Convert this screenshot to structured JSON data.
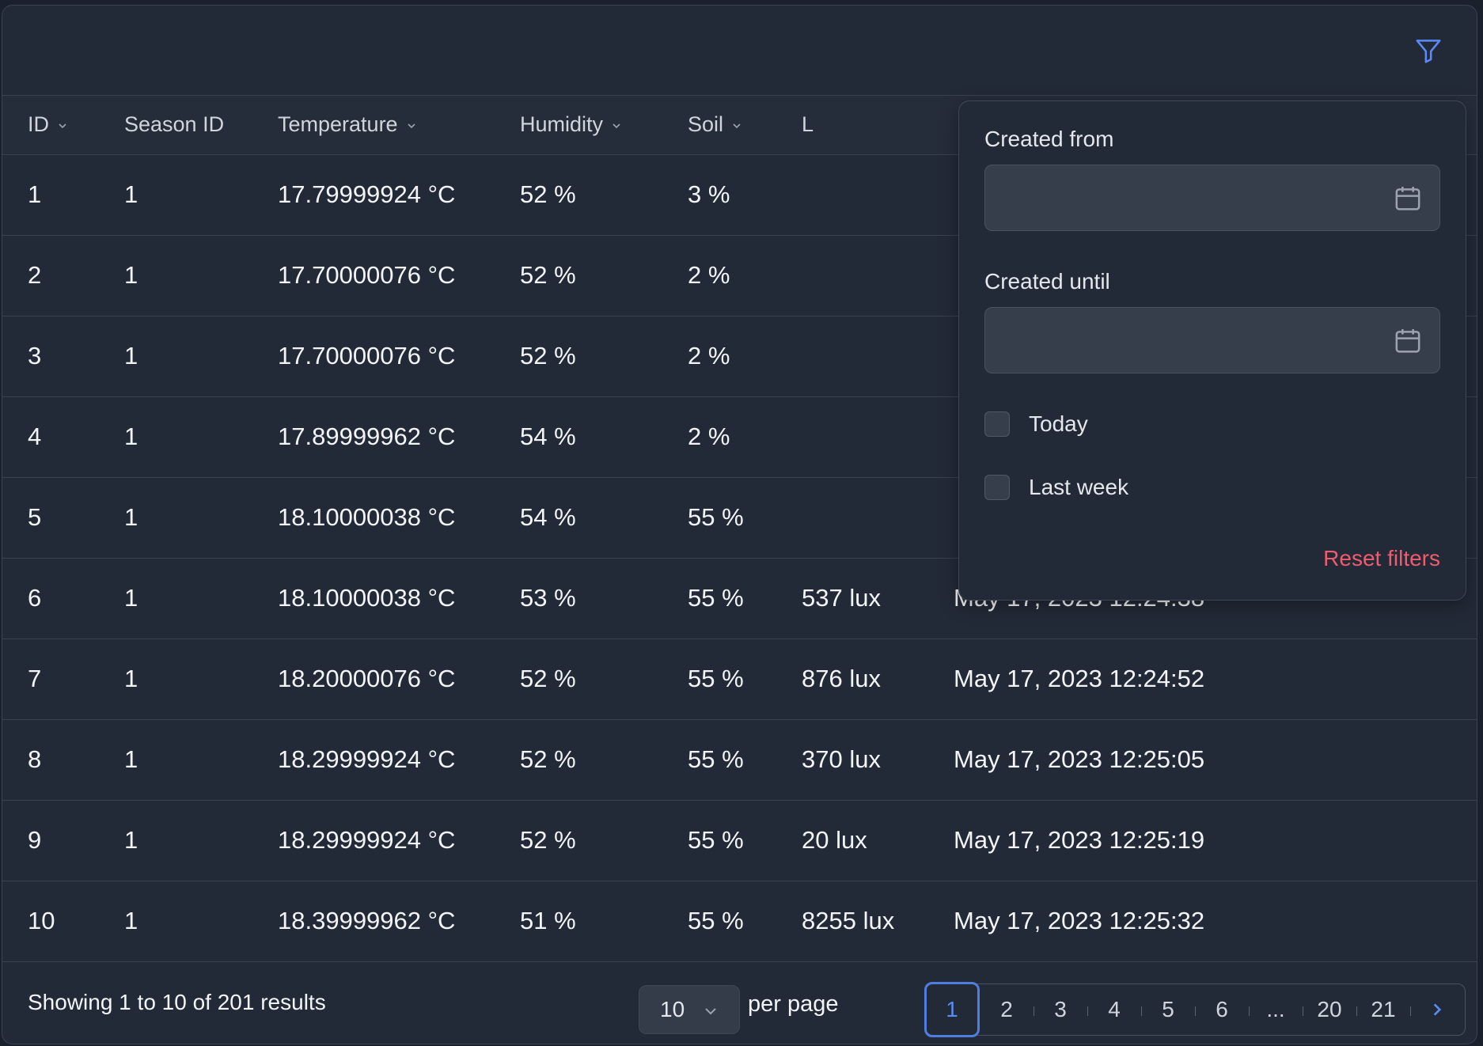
{
  "table": {
    "columns": [
      "ID",
      "Season ID",
      "Temperature",
      "Humidity",
      "Soil",
      "L",
      ""
    ],
    "rows": [
      [
        "1",
        "1",
        "17.79999924 °C",
        "52 %",
        "3 %",
        "",
        ""
      ],
      [
        "2",
        "1",
        "17.70000076 °C",
        "52 %",
        "2 %",
        "",
        ""
      ],
      [
        "3",
        "1",
        "17.70000076 °C",
        "52 %",
        "2 %",
        "",
        ""
      ],
      [
        "4",
        "1",
        "17.89999962 °C",
        "54 %",
        "2 %",
        "",
        ""
      ],
      [
        "5",
        "1",
        "18.10000038 °C",
        "54 %",
        "55 %",
        "",
        ""
      ],
      [
        "6",
        "1",
        "18.10000038 °C",
        "53 %",
        "55 %",
        "537 lux",
        "May 17, 2023 12:24:38"
      ],
      [
        "7",
        "1",
        "18.20000076 °C",
        "52 %",
        "55 %",
        "876 lux",
        "May 17, 2023 12:24:52"
      ],
      [
        "8",
        "1",
        "18.29999924 °C",
        "52 %",
        "55 %",
        "370 lux",
        "May 17, 2023 12:25:05"
      ],
      [
        "9",
        "1",
        "18.29999924 °C",
        "52 %",
        "55 %",
        "20 lux",
        "May 17, 2023 12:25:19"
      ],
      [
        "10",
        "1",
        "18.39999962 °C",
        "51 %",
        "55 %",
        "8255 lux",
        "May 17, 2023 12:25:32"
      ]
    ]
  },
  "footer": {
    "showing_text": "Showing 1 to 10 of 201 results",
    "per_page_value": "10",
    "per_page_label": "per page",
    "pages": [
      "1",
      "2",
      "3",
      "4",
      "5",
      "6",
      "...",
      "20",
      "21"
    ],
    "active_page": "1"
  },
  "filter_panel": {
    "created_from_label": "Created from",
    "created_until_label": "Created until",
    "today_label": "Today",
    "last_week_label": "Last week",
    "reset_label": "Reset filters"
  },
  "colors": {
    "background": "#232a37",
    "accent": "#5b8bf7",
    "danger": "#ef5c6d"
  },
  "icons": {
    "filter": "filter-funnel-icon",
    "calendar": "calendar-icon",
    "sort": "chevron-down-icon",
    "next": "chevron-right-icon"
  }
}
